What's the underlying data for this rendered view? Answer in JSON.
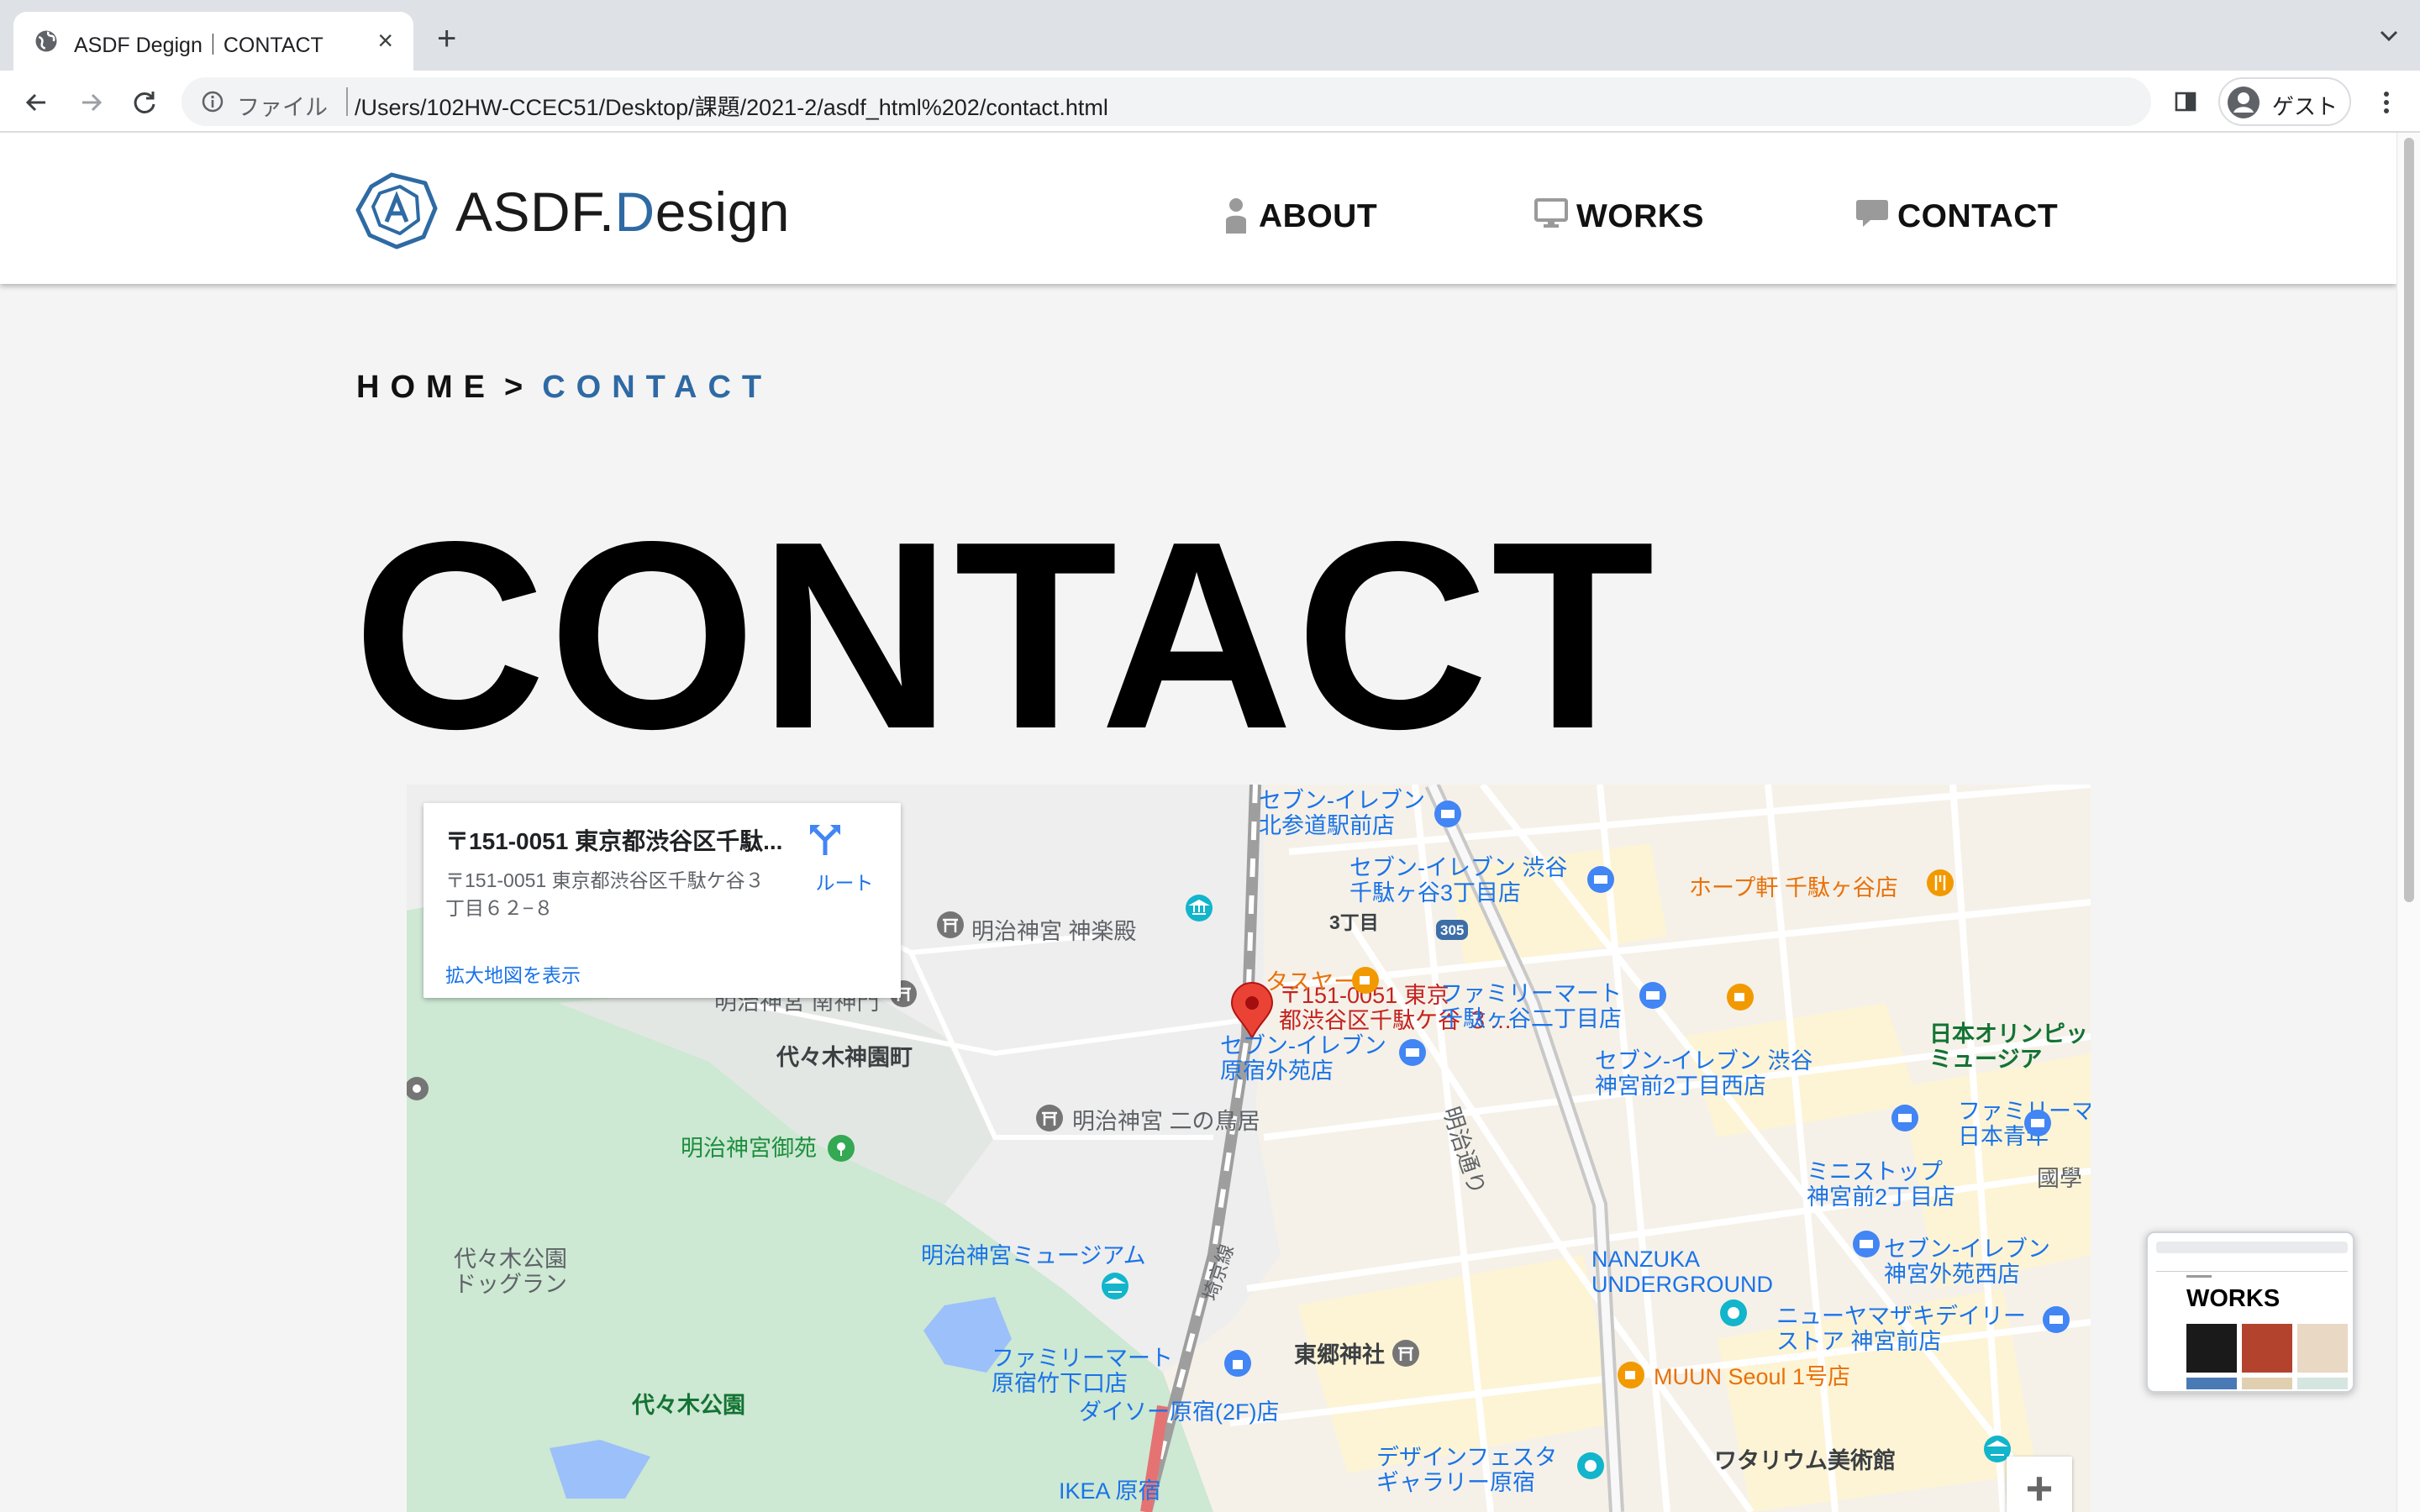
{
  "browser": {
    "tab_title": "ASDF Degign｜CONTACT",
    "close_glyph": "×",
    "new_tab_glyph": "+",
    "address_chip": "ファイル",
    "url": "/Users/102HW-CCEC51/Desktop/課題/2021-2/asdf_html%202/contact.html",
    "profile_label": "ゲスト"
  },
  "header": {
    "logo_text_pre": "ASDF.",
    "logo_text_accent": "D",
    "logo_text_post": "esign",
    "nav": [
      {
        "label": "ABOUT",
        "icon": "person-icon"
      },
      {
        "label": "WORKS",
        "icon": "monitor-icon"
      },
      {
        "label": "CONTACT",
        "icon": "speech-bubble-icon"
      }
    ]
  },
  "breadcrumb": {
    "home": "HOME",
    "separator": ">",
    "current": "CONTACT"
  },
  "page_title": "CONTACT",
  "map": {
    "card": {
      "title": "〒151-0051 東京都渋谷区千駄...",
      "address": "〒151-0051 東京都渋谷区千駄ケ谷３丁目６２−８",
      "route_label": "ルート",
      "larger_map_link": "拡大地図を表示"
    },
    "marker_label": "〒151-0051 東京\n都渋谷区千駄ケ谷 ３…",
    "zoom_in": "+",
    "labels": {
      "seven_kitasando": "セブン-イレブン\n北参道駅前店",
      "seven_sendagaya3": "セブン-イレブン 渋谷\n千駄ヶ谷3丁目店",
      "hopeken": "ホープ軒 千駄ヶ谷店",
      "kaguraden": "明治神宮 神楽殿",
      "sanchome": "3丁目",
      "route305": "305",
      "tasuyado": "タスヤード",
      "familymart_sendagaya2": "ファミリーマート\n千駄ヶ谷二丁目店",
      "minami_shinmon": "明治神宮 南神門",
      "yoyogi_kamizonocho": "代々木神園町",
      "seven_harajuku_gaien": "セブン-イレブン\n原宿外苑店",
      "seven_jingumae2": "セブン-イレブン 渋谷\n神宮前2丁目西店",
      "olympic_museum": "日本オリンピッ\nミュージア",
      "meiji_dori": "明治通り",
      "ni_no_torii": "明治神宮 二の鳥居",
      "gyoen": "明治神宮御苑",
      "familymart_aoyama": "ファミリーマ\n日本青年",
      "ministop": "ミニストップ\n神宮前2丁目店",
      "kokugakuin": "國學",
      "dogrun": "代々木公園\nドッグラン",
      "museum": "明治神宮ミュージアム",
      "nanzuka": "NANZUKA\nUNDERGROUND",
      "seven_jingu_gaien": "セブン-イレブン\n神宮外苑西店",
      "saikyo_line": "埼京線",
      "new_yamazaki": "ニューヤマザキデイリー\nストア 神宮前店",
      "familymart_takeshita": "ファミリーマート\n原宿竹下口店",
      "togo_shrine": "東郷神社",
      "muun": "MUUN Seoul 1号店",
      "daiso": "ダイソー原宿(2F)店",
      "yoyogi_park": "代々木公園",
      "design_festa": "デザインフェスタ\nギャラリー原宿",
      "watarium": "ワタリウム美術館",
      "ikea": "IKEA 原宿"
    }
  },
  "preview": {
    "title": "WORKS"
  },
  "colors": {
    "accent": "#2e6aa3",
    "tabstrip": "#dee1e6",
    "map_park": "#cde8d3",
    "map_block": "#fdf4d6",
    "pin_red": "#ea4335"
  }
}
